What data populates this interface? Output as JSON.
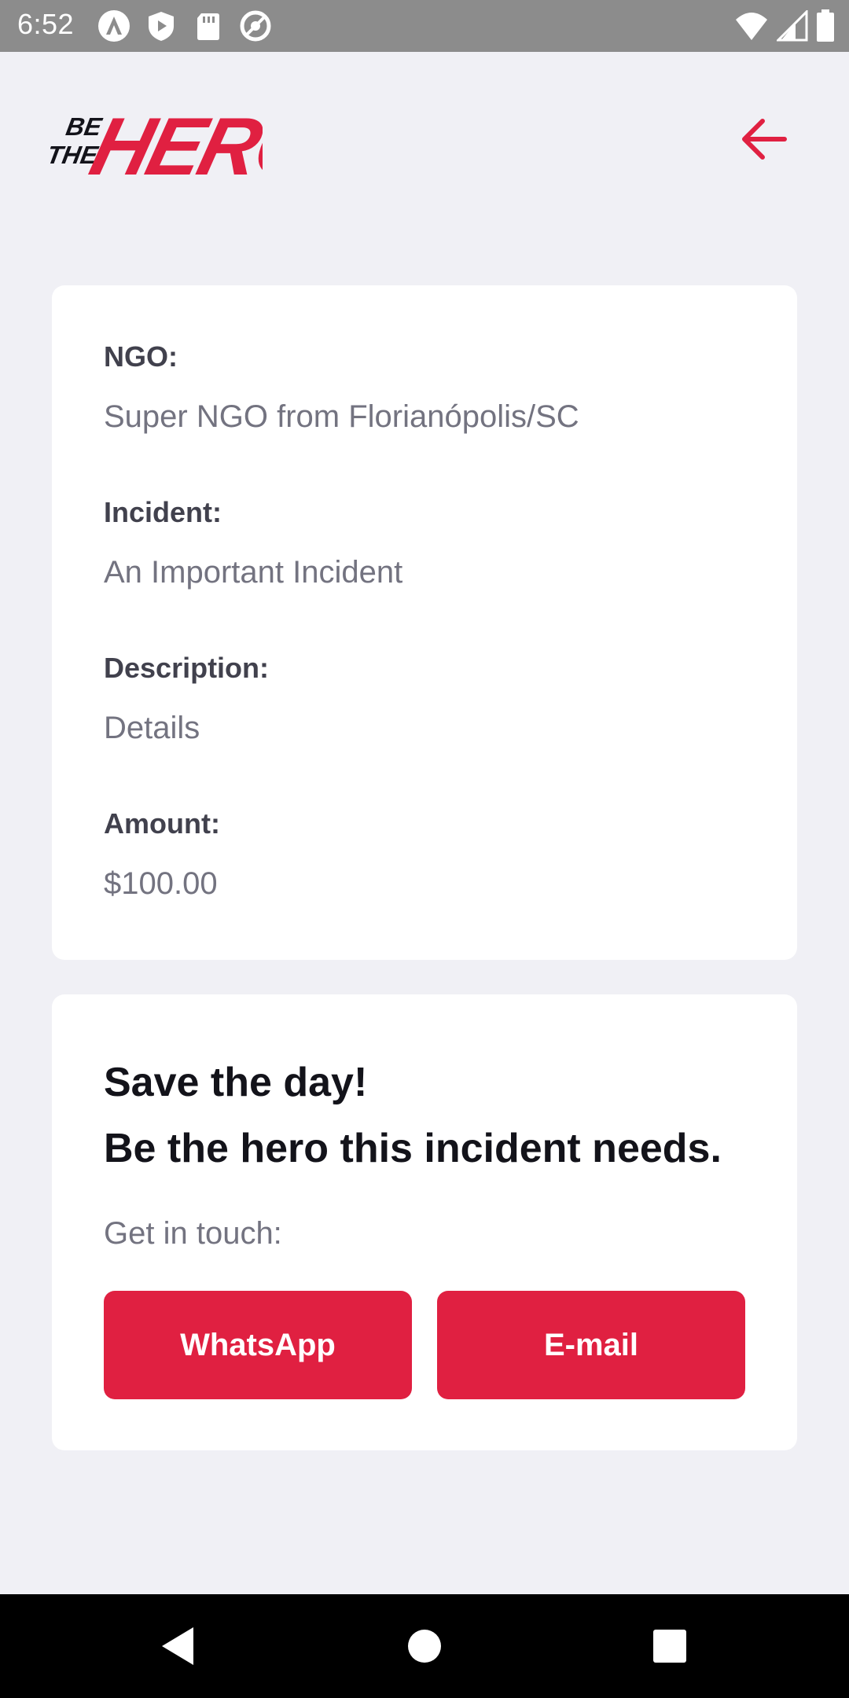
{
  "status_bar": {
    "time": "6:52",
    "left_icons": [
      "android-auto-icon",
      "shield-play-icon",
      "sd-card-icon",
      "at-sign-icon"
    ],
    "right_icons": [
      "wifi-icon",
      "signal-icon",
      "battery-icon"
    ]
  },
  "header": {
    "logo_text": "BE THE HERO",
    "logo_small_1": "BE",
    "logo_small_2": "THE",
    "logo_big": "HERO",
    "back_icon": "arrow-left-icon"
  },
  "incident": {
    "ngo_label": "NGO:",
    "ngo_value": "Super NGO from Florianópolis/SC",
    "incident_label": "Incident:",
    "incident_value": "An Important Incident",
    "description_label": "Description:",
    "description_value": "Details",
    "amount_label": "Amount:",
    "amount_value": "$100.00"
  },
  "contact": {
    "title_line1": "Save the day!",
    "title_line2": "Be the hero this incident needs.",
    "touch_label": "Get in touch:",
    "whatsapp_label": "WhatsApp",
    "email_label": "E-mail"
  },
  "nav_bar": {
    "icons": [
      "nav-back-icon",
      "nav-home-icon",
      "nav-recents-icon"
    ]
  },
  "colors": {
    "accent": "#e02041",
    "background": "#f0f0f5",
    "label": "#41414d",
    "value": "#737380",
    "title": "#13131a"
  }
}
